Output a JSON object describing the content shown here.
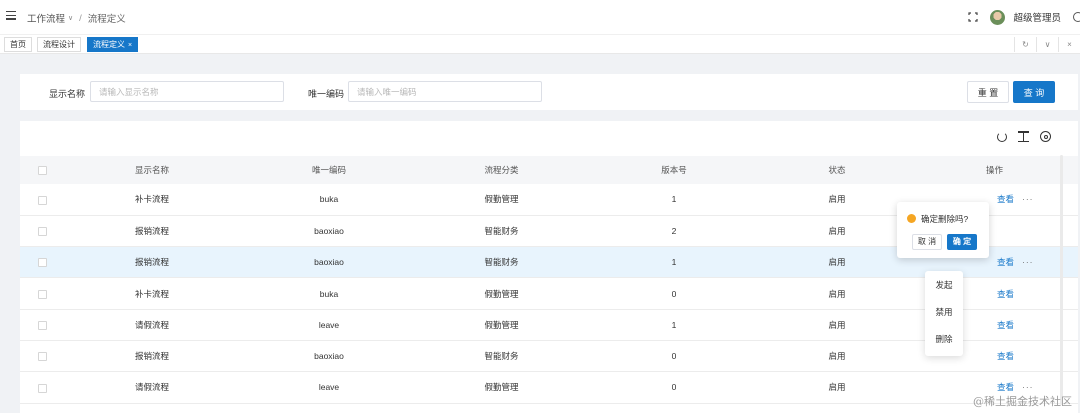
{
  "header": {
    "breadcrumb": [
      "工作流程",
      "流程定义"
    ],
    "breadcrumb_sep": "/",
    "caret": "∨",
    "username": "超级管理员"
  },
  "tabs": [
    {
      "label": "首页",
      "active": false
    },
    {
      "label": "流程设计",
      "active": false
    },
    {
      "label": "流程定义",
      "active": true,
      "close": "×"
    }
  ],
  "tabs_tools": [
    "↻",
    "∨",
    "×"
  ],
  "search": {
    "name_label": "显示名称",
    "name_placeholder": "请输入显示名称",
    "code_label": "唯一编码",
    "code_placeholder": "请输入唯一编码",
    "reset_label": "重 置",
    "query_label": "查 询"
  },
  "table": {
    "columns": [
      "显示名称",
      "唯一编码",
      "流程分类",
      "版本号",
      "状态",
      "操作"
    ],
    "rows": [
      {
        "name": "补卡流程",
        "code": "buka",
        "category": "假勤管理",
        "version": "1",
        "status": "启用"
      },
      {
        "name": "报销流程",
        "code": "baoxiao",
        "category": "智能财务",
        "version": "2",
        "status": "启用"
      },
      {
        "name": "报销流程",
        "code": "baoxiao",
        "category": "智能财务",
        "version": "1",
        "status": "启用"
      },
      {
        "name": "补卡流程",
        "code": "buka",
        "category": "假勤管理",
        "version": "0",
        "status": "启用"
      },
      {
        "name": "请假流程",
        "code": "leave",
        "category": "假勤管理",
        "version": "1",
        "status": "启用"
      },
      {
        "name": "报销流程",
        "code": "baoxiao",
        "category": "智能财务",
        "version": "0",
        "status": "启用"
      },
      {
        "name": "请假流程",
        "code": "leave",
        "category": "假勤管理",
        "version": "0",
        "status": "启用"
      }
    ],
    "view_label": "查看",
    "more_label": "···"
  },
  "popconfirm": {
    "message": "确定删除吗?",
    "cancel_label": "取 消",
    "ok_label": "确 定"
  },
  "dropdown": {
    "items": [
      "发起",
      "禁用",
      "删除"
    ]
  },
  "watermark": "@稀土掘金技术社区",
  "colors": {
    "primary": "#1677c9",
    "warning": "#f5a623",
    "row_hover": "#e8f4fd"
  }
}
